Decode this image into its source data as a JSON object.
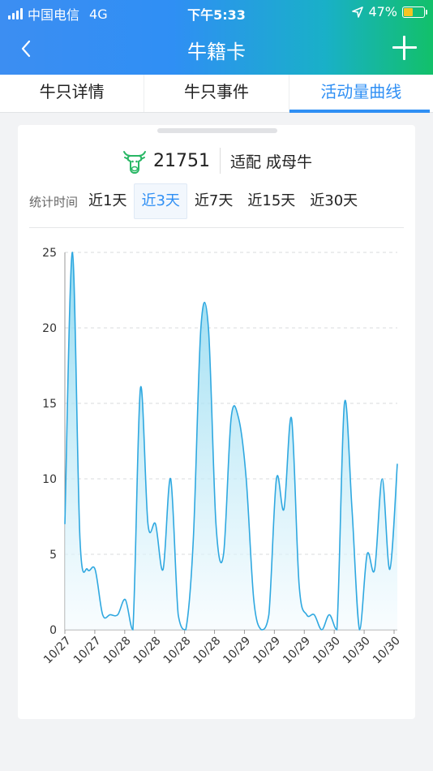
{
  "status_bar": {
    "carrier": "中国电信",
    "network": "4G",
    "time": "下午5:33",
    "battery": "47%",
    "battery_level": 0.47
  },
  "nav": {
    "title": "牛籍卡",
    "back_icon": "chevron-left-icon",
    "add_icon": "plus-icon"
  },
  "tabs": [
    {
      "label": "牛只详情",
      "active": false
    },
    {
      "label": "牛只事件",
      "active": false
    },
    {
      "label": "活动量曲线",
      "active": true
    }
  ],
  "cow": {
    "icon": "cow-head-icon",
    "number": "21751",
    "status": "适配 成母牛"
  },
  "time_filter": {
    "label": "统计时间",
    "options": [
      "近1天",
      "近3天",
      "近7天",
      "近15天",
      "近30天"
    ],
    "selected": "近3天"
  },
  "colors": {
    "accent": "#2f8ff4",
    "line": "#2fa8e0",
    "area_top": "#7fd4ee",
    "area_bottom": "#f4fbfe"
  },
  "chart_data": {
    "type": "area",
    "title": "",
    "xlabel": "",
    "ylabel": "",
    "ylim": [
      0,
      25
    ],
    "yticks": [
      0,
      5,
      10,
      15,
      20,
      25
    ],
    "grid": true,
    "xtick_labels": [
      "10/27",
      "10/27",
      "10/28",
      "10/28",
      "10/28",
      "10/28",
      "10/29",
      "10/29",
      "10/29",
      "10/30",
      "10/30",
      "10/30"
    ],
    "values": [
      7,
      25,
      6,
      4,
      4,
      1,
      1,
      1,
      2,
      0,
      16,
      7,
      7,
      4,
      10,
      1,
      0,
      6,
      20,
      20,
      7,
      5,
      14,
      14,
      10,
      2,
      0,
      1,
      10,
      8,
      14,
      3,
      1,
      1,
      0,
      1,
      0,
      15,
      8,
      0,
      5,
      4,
      10,
      4,
      11
    ]
  }
}
